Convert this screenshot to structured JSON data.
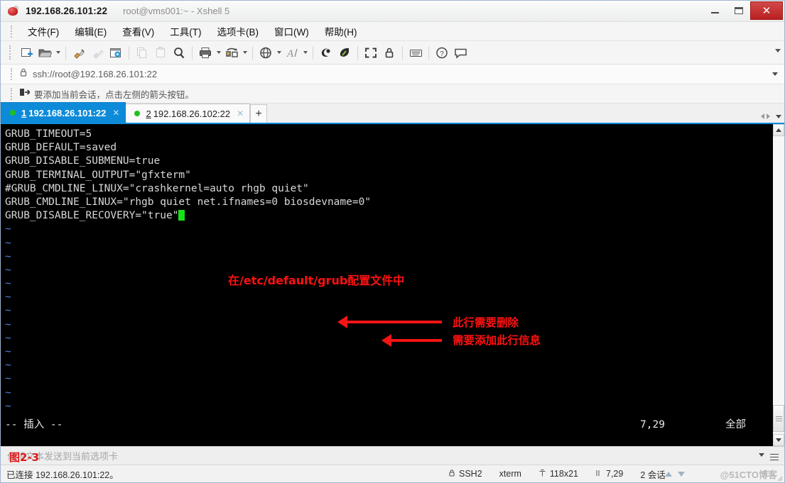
{
  "window": {
    "title_main": "192.168.26.101:22",
    "title_sub": "root@vms001:~ - Xshell 5",
    "app_icon": "xshell-logo-icon",
    "minimize_label": "–",
    "maximize_label": "❐",
    "close_label": "✕"
  },
  "menu": {
    "items": [
      {
        "label": "文件(F)"
      },
      {
        "label": "编辑(E)"
      },
      {
        "label": "查看(V)"
      },
      {
        "label": "工具(T)"
      },
      {
        "label": "选项卡(B)"
      },
      {
        "label": "窗口(W)"
      },
      {
        "label": "帮助(H)"
      }
    ]
  },
  "toolbar": {
    "icons": [
      {
        "name": "new-session-icon",
        "caret": false
      },
      {
        "name": "open-folder-icon",
        "caret": true
      },
      {
        "name": "sep",
        "caret": false
      },
      {
        "name": "connect-plug-icon",
        "caret": false
      },
      {
        "name": "disconnect-plug-icon",
        "caret": false
      },
      {
        "name": "session-properties-icon",
        "caret": false
      },
      {
        "name": "sep",
        "caret": false
      },
      {
        "name": "copy-icon",
        "caret": false
      },
      {
        "name": "paste-icon",
        "caret": false
      },
      {
        "name": "find-icon",
        "caret": false
      },
      {
        "name": "sep",
        "caret": false
      },
      {
        "name": "print-icon",
        "caret": true
      },
      {
        "name": "file-transfer-icon",
        "caret": true
      },
      {
        "name": "sep",
        "caret": false
      },
      {
        "name": "globe-icon",
        "caret": true
      },
      {
        "name": "font-icon",
        "caret": true
      },
      {
        "name": "sep",
        "caret": false
      },
      {
        "name": "xftp-icon",
        "caret": false
      },
      {
        "name": "xagent-icon",
        "caret": false
      },
      {
        "name": "sep",
        "caret": false
      },
      {
        "name": "fullscreen-icon",
        "caret": false
      },
      {
        "name": "lock-icon",
        "caret": false
      },
      {
        "name": "sep",
        "caret": false
      },
      {
        "name": "keyboard-icon",
        "caret": false
      },
      {
        "name": "sep",
        "caret": false
      },
      {
        "name": "help-icon",
        "caret": false
      },
      {
        "name": "chat-icon",
        "caret": false
      }
    ]
  },
  "address_bar": {
    "lock_icon": "lock-icon",
    "url": "ssh://root@192.168.26.101:22"
  },
  "hint_bar": {
    "icon": "add-session-arrow-icon",
    "text": "要添加当前会话，点击左侧的箭头按钮。"
  },
  "tabs": {
    "items": [
      {
        "num": "1",
        "label": "192.168.26.101:22",
        "active": true,
        "close": "✕",
        "status_color": "#21c021"
      },
      {
        "num": "2",
        "label": "192.168.26.102:22",
        "active": false,
        "close": "✕",
        "status_color": "#21c021"
      }
    ],
    "add_label": "+"
  },
  "terminal": {
    "lines": [
      "GRUB_TIMEOUT=5",
      "GRUB_DEFAULT=saved",
      "GRUB_DISABLE_SUBMENU=true",
      "GRUB_TERMINAL_OUTPUT=\"gfxterm\"",
      "#GRUB_CMDLINE_LINUX=\"crashkernel=auto rhgb quiet\"",
      "GRUB_CMDLINE_LINUX=\"rhgb quiet net.ifnames=0 biosdevname=0\"",
      "GRUB_DISABLE_RECOVERY=\"true\""
    ],
    "tilde": "~",
    "tilde_count": 14,
    "cursor_color": "#19e019",
    "vim_status": {
      "mode": "-- 插入 --",
      "position": "7,29",
      "scroll": "全部"
    }
  },
  "annotations": {
    "color": "#ff1111",
    "title": "在/etc/default/grub配置文件中",
    "delete_line": "此行需要删除",
    "add_line": "需要添加此行信息",
    "figure_caption": "图2-3"
  },
  "send_bar": {
    "placeholder": "仅将文本发送到当前选项卡"
  },
  "status_bar": {
    "connection": "已连接 192.168.26.101:22。",
    "protocol": "SSH2",
    "terminal_type": "xterm",
    "size": "118x21",
    "cursor_pos": "7,29",
    "sessions": "2 会话",
    "watermark": "@51CTO博客"
  }
}
